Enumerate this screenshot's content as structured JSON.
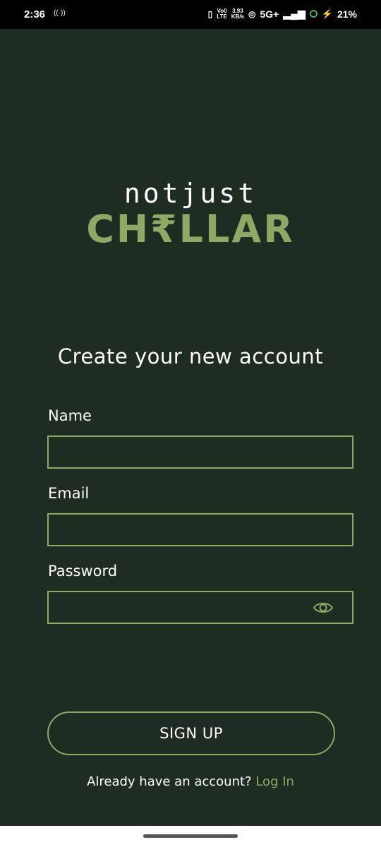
{
  "status_bar": {
    "time": "2:36",
    "cast_icon": "((·))",
    "volte_line1": "Vo0",
    "volte_line2": "LTE",
    "speed_value": "3.93",
    "speed_unit": "KB/s",
    "network": "5G+",
    "battery": "21%"
  },
  "logo": {
    "line1": "notjust",
    "line2": "CH₹LLAR"
  },
  "heading": "Create your new account",
  "form": {
    "name_label": "Name",
    "name_value": "",
    "email_label": "Email",
    "email_value": "",
    "password_label": "Password",
    "password_value": ""
  },
  "signup_label": "SIGN UP",
  "login_prompt": "Already have an account?",
  "login_link": "Log In",
  "colors": {
    "background": "#1f2c22",
    "accent": "#8fa866",
    "text": "#ffffff"
  }
}
